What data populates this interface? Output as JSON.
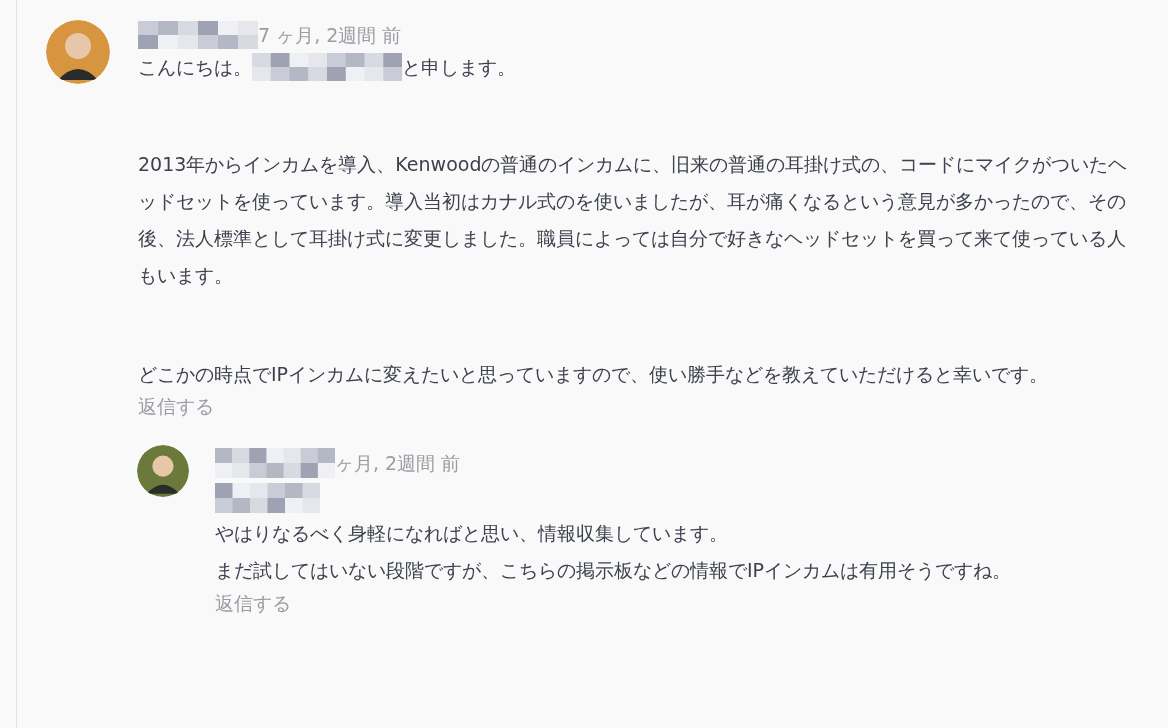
{
  "comment": {
    "timestamp": "7 ヶ月, 2週間 前",
    "greeting": [
      "こんにちは。",
      "と申します。"
    ],
    "paragraphs": [
      "2013年からインカムを導入、Kenwoodの普通のインカムに、旧来の普通の耳掛け式の、コードにマイクがついたヘッドセットを使っています。導入当初はカナル式のを使いましたが、耳が痛くなるという意見が多かったので、その後、法人標準として耳掛け式に変更しました。職員によっては自分で好きなヘッドセットを買って来て使っている人もいます。",
      "どこかの時点でIPインカムに変えたいと思っていますので、使い勝手などを教えていただけると幸いです。"
    ],
    "reply_link": "返信する"
  },
  "reply": {
    "timestamp": "ヶ月, 2週間 前",
    "lines": [
      "やはりなるべく身軽になればと思い、情報収集しています。",
      "まだ試してはいない段階ですが、こちらの掲示板などの情報でIPインカムは有用そうですね。"
    ],
    "reply_link": "返信する"
  }
}
